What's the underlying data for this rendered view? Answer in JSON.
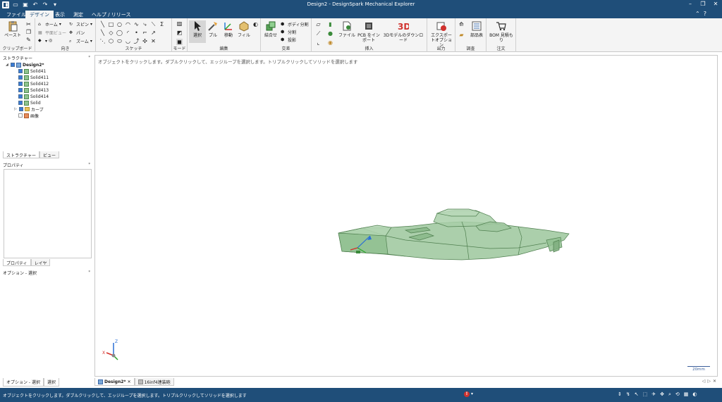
{
  "window": {
    "title": "Design2 - DesignSpark Mechanical Explorer"
  },
  "tabs": [
    {
      "label": "ファイル"
    },
    {
      "label": "デザイン"
    },
    {
      "label": "表示"
    },
    {
      "label": "測定"
    },
    {
      "label": "ヘルプ / リリース"
    }
  ],
  "ribbon": {
    "clipboard": {
      "paste": "ペースト",
      "label": "クリップボード"
    },
    "orient": {
      "home": "ホーム",
      "plane_view": "平面ビュー",
      "spin": "スピン",
      "pan": "パン",
      "zoom": "ズーム",
      "label": "向き"
    },
    "sketch": {
      "label": "スケッチ"
    },
    "mode": {
      "label": "モード"
    },
    "edit": {
      "select": "選択",
      "pull": "プル",
      "move": "移動",
      "fill": "フィル",
      "label": "編集"
    },
    "intersect": {
      "combine": "結合せ",
      "body_split": "ボディ分割",
      "split": "分割",
      "project": "投影",
      "label": "交差"
    },
    "insert": {
      "file": "ファイル",
      "pcb": "PCB をインポート",
      "download3d": "3Dモデルのダウンロード",
      "label": "挿入"
    },
    "output": {
      "export": "エクスポートオプション",
      "label": "出力"
    },
    "investigate": {
      "parts": "部品表",
      "label": "調査"
    },
    "order": {
      "bom": "BOM 見積もり",
      "label": "注文"
    }
  },
  "structure": {
    "title": "ストラクチャー",
    "root": "Design2*",
    "items": [
      {
        "label": "Solid41",
        "checked": true
      },
      {
        "label": "Solid411",
        "checked": true
      },
      {
        "label": "Solid412",
        "checked": true
      },
      {
        "label": "Solid413",
        "checked": true
      },
      {
        "label": "Solid414",
        "checked": true
      },
      {
        "label": "Solid",
        "checked": true
      },
      {
        "label": "カーブ",
        "checked": true
      },
      {
        "label": "画像",
        "checked": false
      }
    ],
    "tabs": [
      "ストラクチャー",
      "ビュー"
    ]
  },
  "properties": {
    "title": "プロパティ",
    "tabs": [
      "プロパティ",
      "レイヤ"
    ]
  },
  "options": {
    "title": "オプション - 選択",
    "tabs": [
      "オプション - 選択",
      "選択"
    ]
  },
  "viewport": {
    "hint": "オブジェクトをクリックします。ダブルクリックして、エッジループを選択します。トリプルクリックしてソリッドを選択します",
    "scale_label": "20mm"
  },
  "documents": [
    {
      "label": "Design2*",
      "active": true
    },
    {
      "label": "16inf4連装砲",
      "active": false
    }
  ],
  "status": {
    "message": "オブジェクトをクリックします。ダブルクリックして、エッジループを選択します。トリプルクリックしてソリッドを選択します",
    "error_badge": "!"
  },
  "colors": {
    "titlebar": "#1f4e79",
    "model_fill": "#9cc79c",
    "model_edge": "#4f7f4f"
  }
}
